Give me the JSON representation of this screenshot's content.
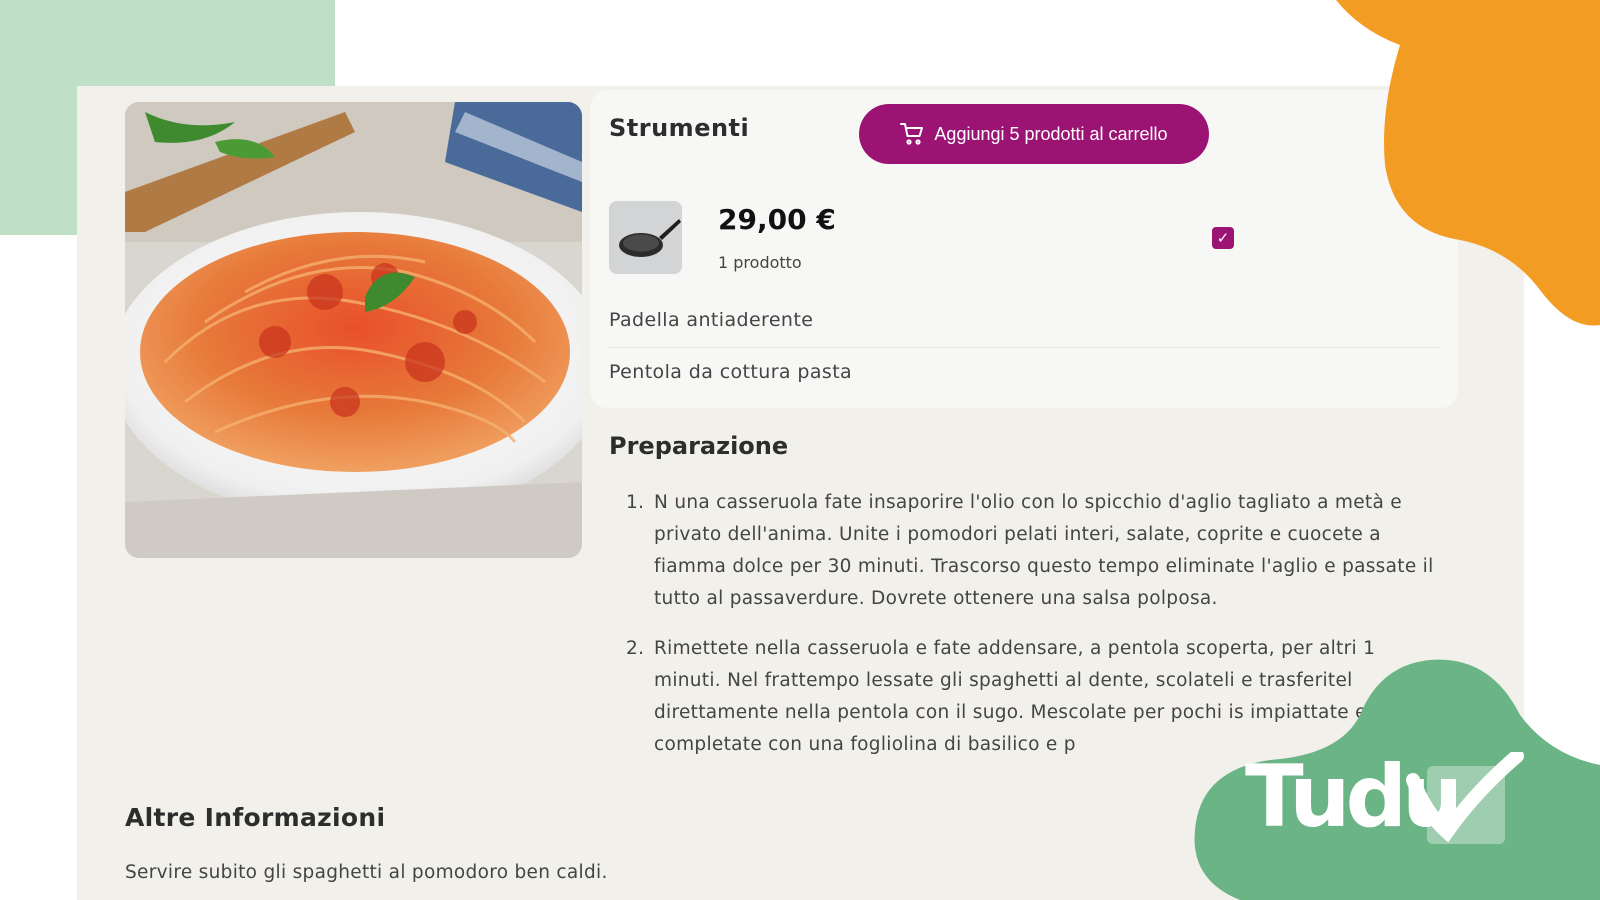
{
  "tools": {
    "title": "Strumenti",
    "cart_button_label": "Aggiungi 5 prodotti al carrello",
    "product": {
      "price": "29,00 €",
      "quantity": "1 prodotto",
      "checked": true,
      "checkmark": "✓",
      "image_icon": "frying-pan-icon"
    },
    "items": [
      "Padella antiaderente",
      "Pentola da cottura pasta"
    ]
  },
  "preparation": {
    "title": "Preparazione",
    "steps": [
      {
        "number": "1.",
        "text": "N una casseruola fate insaporire l'olio con lo spicchio d'aglio tagliato a metà e privato dell'anima. Unite i pomodori pelati interi, salate, coprite e cuocete a fiamma dolce per 30 minuti. Trascorso questo tempo eliminate l'aglio e passate il tutto al passaverdure. Dovrete ottenere una salsa polposa."
      },
      {
        "number": "2.",
        "text": "Rimettete nella casseruola e fate addensare, a pentola scoperta, per altri 1 minuti. Nel frattempo lessate gli spaghetti al dente, scolateli e trasferitel direttamente nella pentola con il sugo. Mescolate per pochi is impiattate e completate con una fogliolina di basilico e p"
      }
    ]
  },
  "other_info": {
    "title": "Altre Informazioni",
    "text": "Servire subito gli spaghetti al pomodoro ben caldi."
  },
  "logo": {
    "text": "Tudu"
  },
  "colors": {
    "accent": "#9c1473",
    "orange_blob": "#f39c24",
    "green_blob": "#6bb485",
    "light_green_blob": "#bfe0c7",
    "page_bg": "#f1f0ea"
  }
}
